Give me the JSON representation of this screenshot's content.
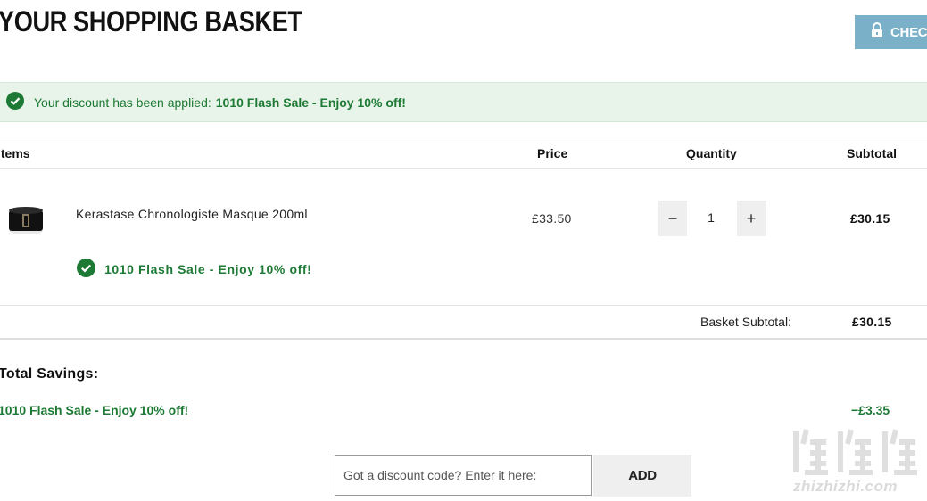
{
  "page": {
    "title": "YOUR SHOPPING BASKET",
    "checkout_label": "CHECKO"
  },
  "alert": {
    "text": "Your discount has been applied:",
    "promo": "1010 Flash Sale - Enjoy 10% off!"
  },
  "table": {
    "headers": {
      "items": "Items",
      "price": "Price",
      "quantity": "Quantity",
      "subtotal": "Subtotal"
    },
    "rows": [
      {
        "name": "Kerastase Chronologiste Masque 200ml",
        "price": "£33.50",
        "quantity": "1",
        "subtotal": "£30.15",
        "promo": "1010 Flash Sale - Enjoy 10% off!",
        "minus": "−",
        "plus": "+"
      }
    ]
  },
  "basket": {
    "subtotal_label": "Basket Subtotal:",
    "subtotal_value": "£30.15"
  },
  "savings": {
    "title": "Total Savings:",
    "name": "1010 Flash Sale - Enjoy 10% off!",
    "value": "−£3.35"
  },
  "discount": {
    "placeholder": "Got a discount code? Enter it here:",
    "button": "ADD"
  },
  "watermark": {
    "text": "zhizhizhi.com"
  },
  "colors": {
    "accent": "#7ab0c8",
    "success": "#1d7a34",
    "alert_bg": "#e8f3ea"
  },
  "icons": {
    "lock": "lock-icon",
    "check": "check-circle-icon",
    "product": "product-thumbnail"
  }
}
